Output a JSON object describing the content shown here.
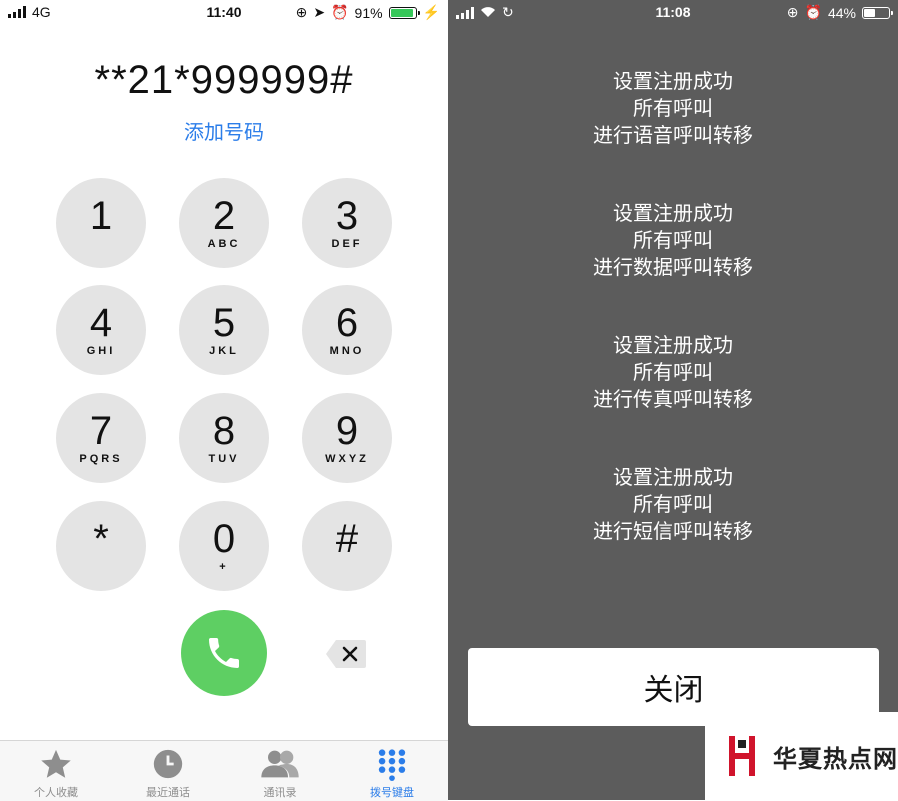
{
  "left": {
    "status": {
      "carrier": "4G",
      "time": "11:40",
      "battery": "91%",
      "battery_level": 0.91
    },
    "dialed_number": "**21*999999#",
    "add_number": "添加号码",
    "keys": [
      {
        "digit": "1",
        "letters": ""
      },
      {
        "digit": "2",
        "letters": "ABC"
      },
      {
        "digit": "3",
        "letters": "DEF"
      },
      {
        "digit": "4",
        "letters": "GHI"
      },
      {
        "digit": "5",
        "letters": "JKL"
      },
      {
        "digit": "6",
        "letters": "MNO"
      },
      {
        "digit": "7",
        "letters": "PQRS"
      },
      {
        "digit": "8",
        "letters": "TUV"
      },
      {
        "digit": "9",
        "letters": "WXYZ"
      },
      {
        "digit": "*",
        "letters": ""
      },
      {
        "digit": "0",
        "letters": "+"
      },
      {
        "digit": "#",
        "letters": ""
      }
    ],
    "tabs": [
      {
        "label": "个人收藏",
        "icon": "star-icon"
      },
      {
        "label": "最近通话",
        "icon": "clock-icon"
      },
      {
        "label": "通讯录",
        "icon": "contacts-icon"
      },
      {
        "label": "拨号键盘",
        "icon": "keypad-icon"
      }
    ],
    "accent_color": "#2b7de9",
    "call_color": "#5ecf63"
  },
  "right": {
    "status": {
      "time": "11:08",
      "battery": "44%",
      "battery_level": 0.44
    },
    "messages": [
      {
        "line1": "设置注册成功",
        "line2": "所有呼叫",
        "line3": "进行语音呼叫转移"
      },
      {
        "line1": "设置注册成功",
        "line2": "所有呼叫",
        "line3": "进行数据呼叫转移"
      },
      {
        "line1": "设置注册成功",
        "line2": "所有呼叫",
        "line3": "进行传真呼叫转移"
      },
      {
        "line1": "设置注册成功",
        "line2": "所有呼叫",
        "line3": "进行短信呼叫转移"
      }
    ],
    "close_label": "关闭"
  },
  "watermark": {
    "text": "华夏热点网",
    "color": "#d0142c"
  }
}
